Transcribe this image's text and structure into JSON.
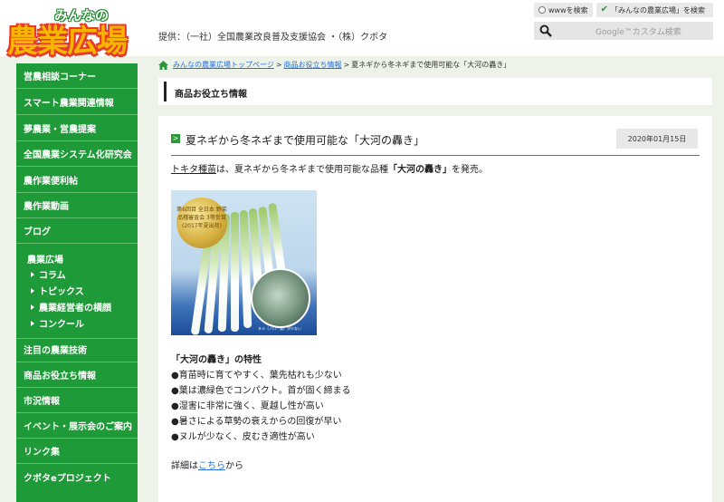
{
  "logo": {
    "small_text": "みんなの",
    "big_text": "農業広場"
  },
  "header": {
    "provider_text": "提供：（一社）全国農業改良普及支援協会 ・（株）クボタ",
    "search_option_www": "wwwを検索",
    "search_option_site": "「みんなの農業広場」を検索",
    "search_placeholder": "Google™カスタム検索"
  },
  "sidebar": {
    "items": [
      "営農相談コーナー",
      "スマート農業関連情報",
      "夢農業・営農提案",
      "全国農業システム化研究会",
      "農作業便利帖",
      "農作業動画",
      "ブログ"
    ],
    "sub_head": "農業広場",
    "sub_items": [
      "コラム",
      "トピックス",
      "農業経営者の横顔",
      "コンクール"
    ],
    "items2": [
      "注目の農業技術",
      "商品お役立ち情報",
      "市況情報",
      "イベント・展示会のご案内",
      "リンク集",
      "クボタeプロジェクト"
    ]
  },
  "breadcrumb": {
    "home": "みんなの農業広場トップページ",
    "sep": ">",
    "section": "商品お役立ち情報",
    "current": "夏ネギから冬ネギまで使用可能な「大河の轟き」"
  },
  "page_title": "商品お役立ち情報",
  "article": {
    "title": "夏ネギから冬ネギまで使用可能な「大河の轟き」",
    "date": "2020年01月15日",
    "lead_link": "トキタ種苗",
    "lead_mid": "は、夏ネギから冬ネギまで使用可能な品種",
    "lead_bold": "「大河の轟き」",
    "lead_end": "を発売。",
    "medal_text": "第6回目 全日本 野菜品種審査会 3等受賞 (2017年夏出荷)",
    "image_caption": "ヌル（ノロ・液）が少ない",
    "features_title": "「大河の轟き」の特性",
    "features": [
      "●育苗時に育てやすく、葉先枯れも少ない",
      "●葉は濃緑色でコンパクト。首が固く締まる",
      "●湿害に非常に強く、夏越し性が高い",
      "●暑さによる草勢の衰えからの回復が早い",
      "●ヌルが少なく、皮むき適性が高い"
    ],
    "more_prefix": "詳細は",
    "more_link": "こちら",
    "more_suffix": "から"
  },
  "colors": {
    "brand_green": "#1f9a38",
    "link_blue": "#2a6fd6"
  }
}
